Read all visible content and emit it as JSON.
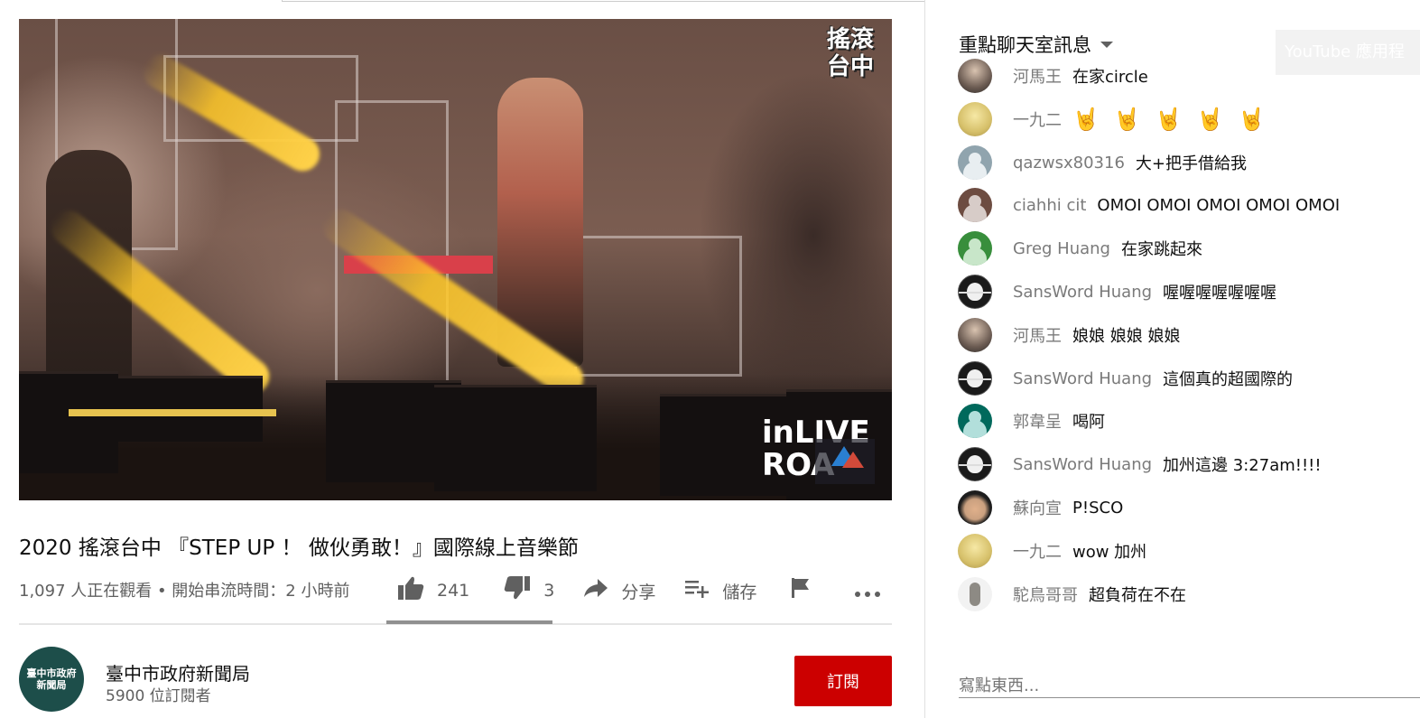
{
  "video": {
    "logo_top_right": "搖滾\n台中",
    "logo_bottom_right": "inLIVE\nROA",
    "title": "2020 搖滾台中 『STEP UP ！ 做伙勇敢！』國際線上音樂節",
    "meta": "1,097 人正在觀看 • 開始串流時間：2 小時前"
  },
  "actions": {
    "like_icon": "thumbs-up-icon",
    "like_count": "241",
    "dislike_icon": "thumbs-down-icon",
    "dislike_count": "3",
    "share_icon": "share-arrow-icon",
    "share_label": "分享",
    "save_icon": "playlist-add-icon",
    "save_label": "儲存",
    "flag_icon": "flag-icon",
    "more_icon": "more-horizontal-icon"
  },
  "channel": {
    "avatar_text": "臺中市政府\n新聞局",
    "name": "臺中市政府新聞局",
    "subscribers": "5900 位訂閱者",
    "subscribe_label": "訂閱"
  },
  "chat": {
    "title": "重點聊天室訊息",
    "app_badge": "YouTube 應用程",
    "input_placeholder": "寫點東西...",
    "messages": [
      {
        "author": "河馬王",
        "text": "在家circle",
        "avatar": "photo"
      },
      {
        "author": "一九二",
        "text": "",
        "hands": 5,
        "avatar": "yellow"
      },
      {
        "author": "qazwsx80316",
        "text": "大+把手借給我",
        "avatar": "gray"
      },
      {
        "author": "ciahhi cit",
        "text": "OMOI OMOI OMOI OMOI OMOI",
        "avatar": "brown"
      },
      {
        "author": "Greg Huang",
        "text": "在家跳起來",
        "avatar": "green"
      },
      {
        "author": "SansWord Huang",
        "text": "喔喔喔喔喔喔喔",
        "avatar": "mask"
      },
      {
        "author": "河馬王",
        "text": "娘娘 娘娘 娘娘",
        "avatar": "photo"
      },
      {
        "author": "SansWord Huang",
        "text": "這個真的超國際的",
        "avatar": "mask"
      },
      {
        "author": "郭韋呈",
        "text": "喝阿",
        "avatar": "teal"
      },
      {
        "author": "SansWord Huang",
        "text": "加州這邊 3:27am!!!!",
        "avatar": "mask"
      },
      {
        "author": "蘇向宣",
        "text": "P!SCO",
        "avatar": "man"
      },
      {
        "author": "一九二",
        "text": "wow 加州",
        "avatar": "yellow"
      },
      {
        "author": "駝鳥哥哥",
        "text": "超負荷在不在",
        "avatar": "bird"
      }
    ]
  },
  "colors": {
    "subscribe_red": "#cc0000",
    "text_primary": "#0f0f0f",
    "text_secondary": "#606060",
    "beam_yellow": "#ffd24a"
  }
}
